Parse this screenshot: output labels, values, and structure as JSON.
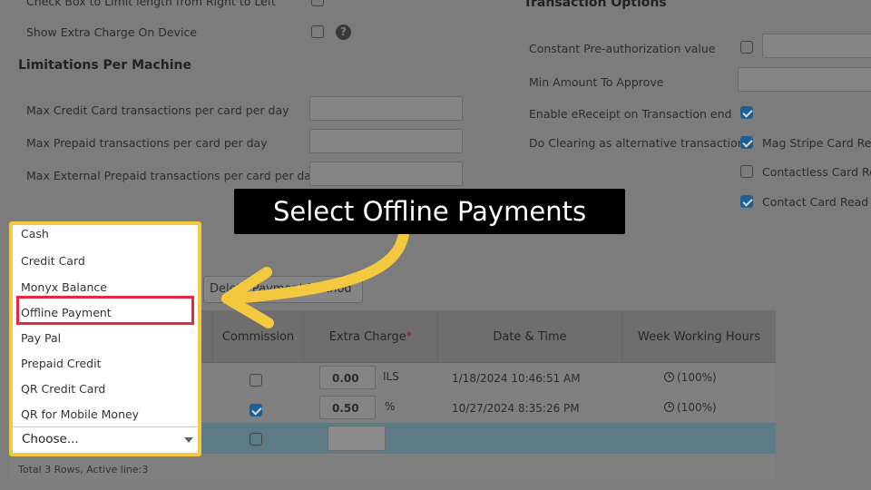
{
  "settings": {
    "check_rtl_label": "Check Box to Limit length from Right to Left",
    "show_extra_charge_label": "Show Extra Charge On Device",
    "help_glyph": "?"
  },
  "limitations": {
    "title": "Limitations Per Machine",
    "max_credit_label": "Max Credit Card transactions per card per day",
    "max_prepaid_label": "Max Prepaid transactions per card per day",
    "max_external_label": "Max External Prepaid transactions per card per day"
  },
  "transaction_options": {
    "title": "Transaction Options",
    "constant_preauth_label": "Constant Pre-authorization value",
    "min_amount_label": "Min Amount To Approve",
    "enable_ereceipt_label": "Enable eReceipt on Transaction end",
    "do_clearing_label": "Do Clearing as alternative transaction",
    "mag_stripe_label": "Mag Stripe Card Rea",
    "contactless_label": "Contactless Card Re",
    "contact_card_label": "Contact Card Read"
  },
  "banner_text": "Select Offline Payments",
  "delete_button_label": "Delete Payment Method",
  "grid": {
    "headers": {
      "commission": "Commission",
      "extra_charge": "Extra Charge",
      "required_mark": "*",
      "datetime": "Date & Time",
      "week_hours": "Week Working Hours"
    },
    "rows": [
      {
        "extra_value": "0.00",
        "unit": "ILS",
        "datetime": "1/18/2024 10:46:51 AM",
        "hours": "(100%)",
        "commission": false
      },
      {
        "extra_value": "0.50",
        "unit": "%",
        "datetime": "10/27/2024 8:35:26 PM",
        "hours": "(100%)",
        "commission": true
      }
    ],
    "footer": "Total 3 Rows, Active line:3"
  },
  "dropdown": {
    "items": [
      "Cash",
      "Credit Card",
      "Monyx Balance",
      "Offline Payment",
      "Pay Pal",
      "Prepaid Credit",
      "QR Credit Card",
      "QR for Mobile Money"
    ],
    "highlighted": "Offline Payment",
    "selected_placeholder": "Choose..."
  },
  "colors": {
    "annotation_border": "#f4c93f",
    "highlight_border": "#e8263f",
    "arrow": "#f4c93f"
  }
}
